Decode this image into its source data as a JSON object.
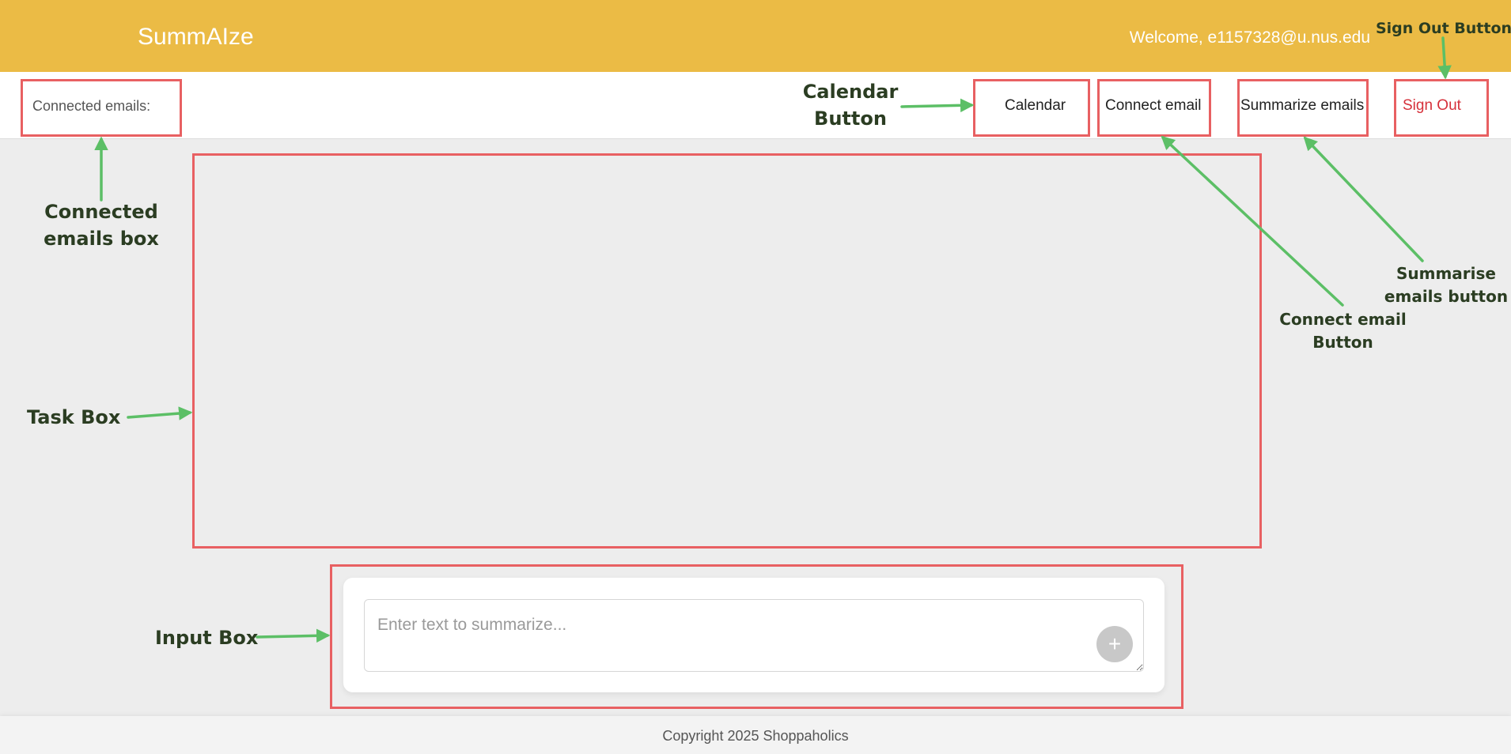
{
  "header": {
    "app_title": "SummAIze",
    "welcome_text": "Welcome, e1157328@u.nus.edu"
  },
  "toolbar": {
    "connected_emails_label": "Connected emails:",
    "calendar_label": "Calendar",
    "connect_email_label": "Connect email",
    "summarize_emails_label": "Summarize emails",
    "sign_out_label": "Sign Out"
  },
  "annotations": {
    "sign_out_button": "Sign Out Button",
    "calendar_button_line1": "Calendar",
    "calendar_button_line2": "Button",
    "connected_emails_box_line1": "Connected",
    "connected_emails_box_line2": "emails box",
    "task_box": "Task Box",
    "summarise_emails_button_line1": "Summarise",
    "summarise_emails_button_line2": "emails button",
    "connect_email_button_line1": "Connect email",
    "connect_email_button_line2": "Button",
    "input_box": "Input Box"
  },
  "input": {
    "placeholder": "Enter text to summarize...",
    "value": "",
    "add_icon": "plus-icon",
    "add_symbol": "+"
  },
  "footer": {
    "copyright": "Copyright 2025 Shoppaholics"
  },
  "colors": {
    "header_bg": "#ebbb45",
    "annotation_box": "#e86062",
    "annotation_arrow": "#5cbf66",
    "annotation_text": "#2b3d22",
    "sign_out_text": "#d6303a"
  }
}
